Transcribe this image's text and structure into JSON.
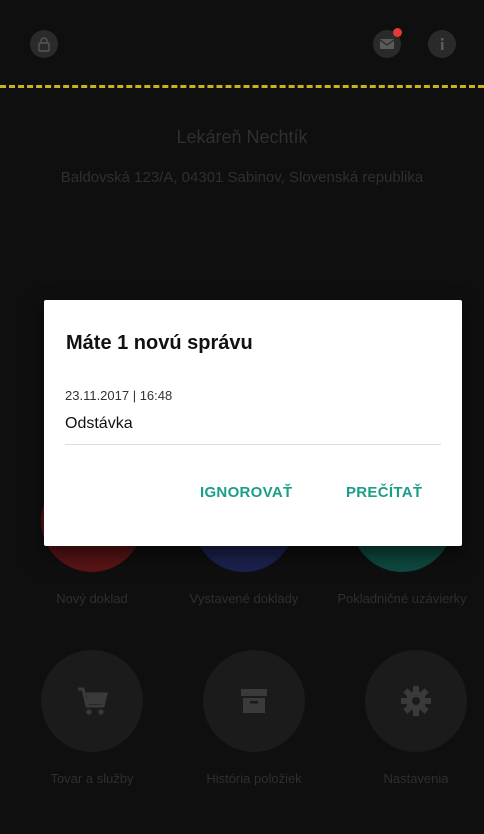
{
  "store": {
    "name": "Lekáreň Nechtík",
    "address": "Baldovská 123/A, 04301 Sabinov, Slovenská republika"
  },
  "tiles": [
    {
      "label": "Nový doklad",
      "icon": "document-icon",
      "accent": "#e53935"
    },
    {
      "label": "Vystavené doklady",
      "icon": "documents-icon",
      "accent": "#3f51b5"
    },
    {
      "label": "Pokladničné uzávierky",
      "icon": "register-icon",
      "accent": "#1a9e88"
    },
    {
      "label": "Tovar a služby",
      "icon": "cart-icon"
    },
    {
      "label": "História položiek",
      "icon": "archive-icon"
    },
    {
      "label": "Nastavenia",
      "icon": "gear-icon"
    }
  ],
  "dialog": {
    "title": "Máte 1 novú správu",
    "date": "23.11.2017 | 16:48",
    "subject": "Odstávka",
    "ignore_label": "IGNOROVAŤ",
    "read_label": "PREČÍTAŤ"
  },
  "colors": {
    "accent": "#1a9e88",
    "background": "#0f0f0f",
    "badge": "#e53935",
    "topbar_dash": "#c9b21a"
  }
}
